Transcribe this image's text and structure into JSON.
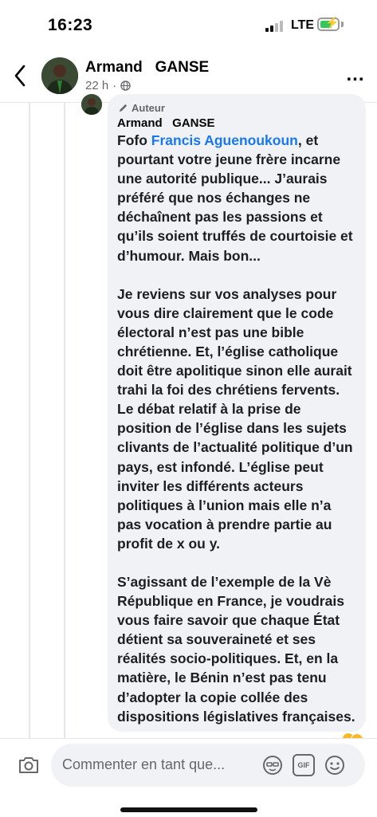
{
  "status_bar": {
    "time": "16:23",
    "network": "LTE",
    "icons": [
      "signal-bars-icon",
      "battery-charging-icon"
    ]
  },
  "header": {
    "name": "Armand   GANSE",
    "time_ago": "22 h",
    "separator": "·",
    "icons": [
      "back-chevron-icon",
      "globe-icon",
      "more-dots-icon"
    ],
    "more_label": "..."
  },
  "comment": {
    "badge": "Auteur",
    "author": "Armand   GANSE",
    "p1_prefix": "Fofo ",
    "mention": "Francis Aguenoukoun",
    "p1_rest": ", et pourtant votre jeune frère incarne une autorité publique... J’aurais préféré que nos échanges ne déchaînent pas les passions et qu’ils soient truffés de courtoisie et d’humour. Mais bon...",
    "p2": "Je reviens sur vos analyses pour vous dire clairement que le code électoral n’est pas une bible chrétienne. Et, l’église catholique doit être apolitique sinon elle aurait trahi la foi des chrétiens fervents. Le débat relatif à la prise de position de l’église dans les sujets clivants de l’actualité politique d’un pays, est infondé. L’église peut inviter les différents acteurs politiques à l’union mais elle n’a pas vocation à prendre partie au profit de x ou y.",
    "p3": "S’agissant de l’exemple de la Vè République en France, je voudrais vous faire savoir que chaque État détient sa souveraineté et ses réalités socio-politiques. Et, en la matière, le Bénin n’est pas tenu d’adopter la copie collée des dispositions législatives françaises."
  },
  "composer": {
    "placeholder": "Commenter en tant que...",
    "gif_label": "GIF",
    "icons": [
      "camera-icon",
      "avatar-sticker-icon",
      "gif-icon",
      "emoji-icon"
    ]
  },
  "colors": {
    "mention": "#1877f2",
    "bubble": "#f0f2f5",
    "secondary_text": "#65676b"
  }
}
